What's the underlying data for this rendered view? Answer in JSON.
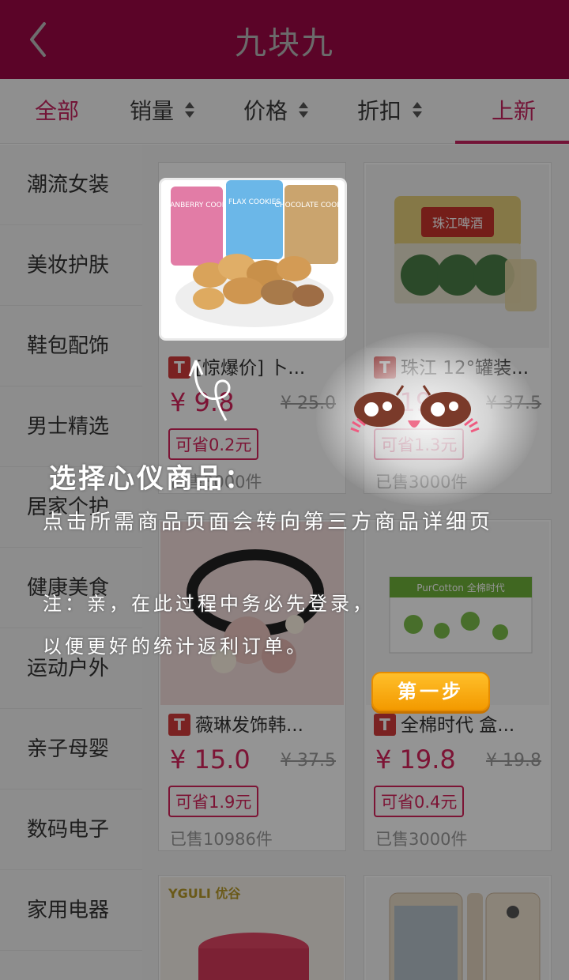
{
  "header": {
    "title": "九块九"
  },
  "sort_tabs": [
    {
      "label": "全部",
      "active": true,
      "sortable": false
    },
    {
      "label": "销量",
      "active": false,
      "sortable": true
    },
    {
      "label": "价格",
      "active": false,
      "sortable": true
    },
    {
      "label": "折扣",
      "active": false,
      "sortable": true
    },
    {
      "label": "上新",
      "active": false,
      "sortable": false
    }
  ],
  "sidebar": {
    "items": [
      "潮流女装",
      "美妆护肤",
      "鞋包配饰",
      "男士精选",
      "居家个护",
      "健康美食",
      "运动户外",
      "亲子母婴",
      "数码电子",
      "家用电器"
    ]
  },
  "products": [
    {
      "title": "[惊爆价] 卜...",
      "price": "¥ 9.8",
      "orig": "¥ 25.0",
      "save": "可省0.2元",
      "sold": "已售3000件"
    },
    {
      "title": "珠江 12°罐装...",
      "price": "¥ 19.8",
      "orig": "¥ 37.5",
      "save": "可省1.3元",
      "sold": "已售3000件"
    },
    {
      "title": "薇琳发饰韩...",
      "price": "¥ 15.0",
      "orig": "¥ 37.5",
      "save": "可省1.9元",
      "sold": "已售10986件"
    },
    {
      "title": "全棉时代 盒...",
      "price": "¥ 19.8",
      "orig": "¥ 19.8",
      "save": "可省0.4元",
      "sold": "已售3000件"
    },
    {
      "brand": "YGULI 优谷"
    },
    {
      "brand": ""
    }
  ],
  "cookie_pack_labels": [
    "CRANBERRY COOKIE",
    "FLAX COOKIES",
    "CHOCOLATE COOKIE"
  ],
  "beer_box_label": "珠江啤酒",
  "cotton_box_label": "PurCotton 全棉时代",
  "guide": {
    "title": "选择心仪商品：",
    "line1": "点击所需商品页面会转向第三方商品详细页",
    "note1": "注：亲，在此过程中务必先登录，",
    "note2": "以便更好的统计返利订单。",
    "step_button": "第一步"
  },
  "colors": {
    "header_bg": "#9e0845",
    "accent": "#c6245f",
    "price": "#d6245c",
    "step_button": "#f5a800"
  },
  "icons": [
    "back-arrow-icon",
    "sort-arrows-icon",
    "tmall-icon",
    "cat-face-icon",
    "hand-pointer-icon"
  ]
}
